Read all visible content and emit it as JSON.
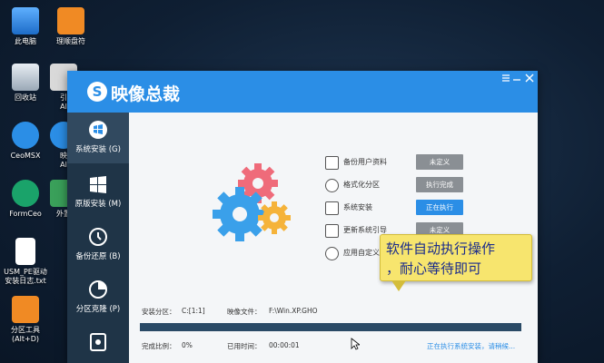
{
  "desktop": {
    "icons": [
      {
        "label": "此电脑"
      },
      {
        "label": "理顺盘符"
      },
      {
        "label": "回收站"
      },
      {
        "label": "引\nAl"
      },
      {
        "label": "CeoMSX"
      },
      {
        "label": "映\nAl"
      },
      {
        "label": "FormCeo"
      },
      {
        "label": "外置"
      },
      {
        "label": "USM_PE驱动\n安装日志.txt"
      },
      {
        "label": "分区工具\n(Alt+D)"
      }
    ]
  },
  "app": {
    "title": "映像总裁",
    "logo_glyph": "S",
    "sidebar": [
      {
        "label": "系统安装 (G)",
        "icon": "windows-icon"
      },
      {
        "label": "原版安装 (M)",
        "icon": "windows-logo-icon"
      },
      {
        "label": "备份还原 (B)",
        "icon": "clock-icon"
      },
      {
        "label": "分区克隆 (P)",
        "icon": "pie-chart-icon"
      },
      {
        "label": "",
        "icon": "disk-icon"
      }
    ],
    "tasks": [
      {
        "label": "备份用户资料",
        "status": "未定义",
        "state": "grey"
      },
      {
        "label": "格式化分区",
        "status": "执行完成",
        "state": "grey"
      },
      {
        "label": "系统安装",
        "status": "正在执行",
        "state": "blue"
      },
      {
        "label": "更新系统引导",
        "status": "未定义",
        "state": "grey"
      },
      {
        "label": "应用自定义",
        "status": "",
        "state": "none"
      }
    ],
    "install_partition_label": "安装分区：",
    "install_partition_value": "C:[1:1]",
    "image_file_label": "映像文件：",
    "image_file_value": "F:\\Win.XP.GHO",
    "progress_percent": 0,
    "completion_label": "完成比例：",
    "completion_value": "0%",
    "elapsed_label": "已用时间：",
    "elapsed_value": "00:00:01",
    "status_link": "正在执行系统安装，请稍候..."
  },
  "tooltip": {
    "line1": "软件自动执行操作",
    "line2": "，耐心等待即可"
  },
  "colors": {
    "accent": "#2b8ee6",
    "sidebar": "#1f3447",
    "tooltip_bg": "#f7e56e"
  }
}
